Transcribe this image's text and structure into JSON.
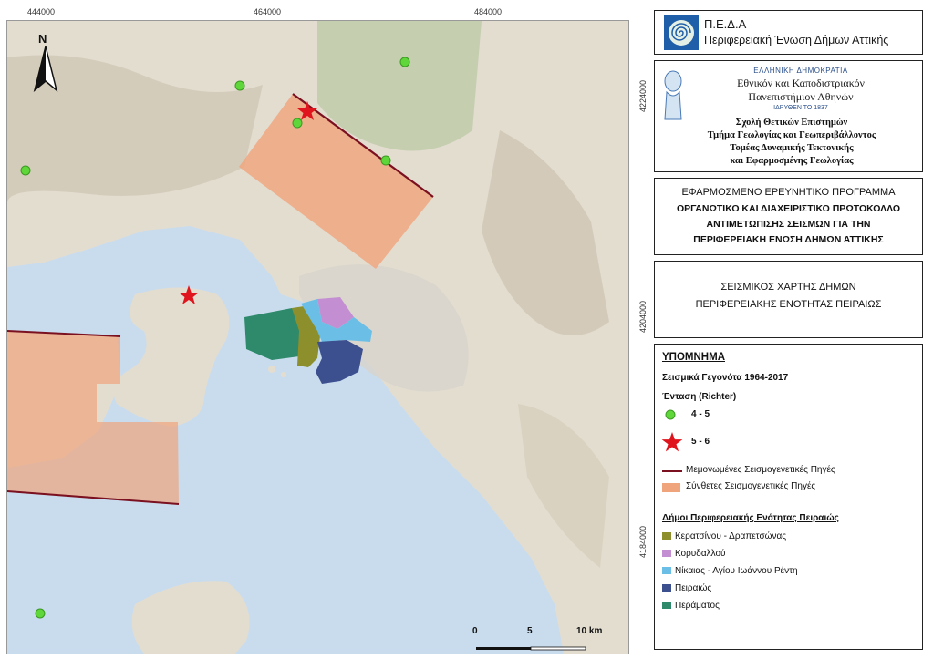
{
  "top_coords": [
    "444000",
    "464000",
    "484000"
  ],
  "side_coords": [
    "4224000",
    "4204000",
    "4184000"
  ],
  "north_arrow": {
    "label": "N",
    "icon": "north-arrow-icon"
  },
  "scalebar": {
    "labels": [
      "0",
      "5",
      "10 km"
    ]
  },
  "colors": {
    "sea": "#c9dcee",
    "land": "#e3ddd0",
    "land_shade": "#cfc6b4",
    "composite_source": "#f0a47c",
    "isolated_source": "#7a1020",
    "event_4_5": "#5fd63a",
    "event_5_6": "#e0141c",
    "keratsini": "#8c8f2c",
    "korydallos": "#c38fd2",
    "nikaia": "#6bbfe6",
    "peiraias": "#3c4f8e",
    "perama": "#2e8a6b"
  },
  "peda": {
    "title": "Π.Ε.Δ.Α",
    "subtitle": "Περιφερειακή Ένωση Δήμων Αττικής",
    "logo_icon": "spiral-logo-icon"
  },
  "university": {
    "state": "ΕΛΛΗΝΙΚΗ ΔΗΜΟΚΡΑΤΙΑ",
    "name_line1": "Εθνικόν και Καποδιστριακόν",
    "name_line2": "Πανεπιστήμιον Αθηνών",
    "founded": "ΙΔΡΥΘΕΝ ΤΟ 1837",
    "line1": "Σχολή Θετικών Επιστημών",
    "line2": "Τμήμα Γεωλογίας και Γεωπεριβάλλοντος",
    "line3": "Τομέας Δυναμικής Τεκτονικής",
    "line4": "και Εφαρμοσμένης Γεωλογίας",
    "logo_icon": "university-seal-icon"
  },
  "program": {
    "title": "ΕΦΑΡΜΟΣΜΕΝΟ ΕΡΕΥΝΗΤΙΚΟ ΠΡΟΓΡΑΜΜΑ",
    "line1": "ΟΡΓΑΝΩΤΙΚΟ ΚΑΙ ΔΙΑΧΕΙΡΙΣΤΙΚΟ ΠΡΩΤΟΚΟΛΛΟ",
    "line2": "ΑΝΤΙΜΕΤΩΠΙΣΗΣ ΣΕΙΣΜΩΝ ΓΙΑ ΤΗΝ",
    "line3": "ΠΕΡΙΦΕΡΕΙΑΚΗ ΕΝΩΣΗ ΔΗΜΩΝ ΑΤΤΙΚΗΣ"
  },
  "map_title": {
    "line1": "ΣΕΙΣΜΙΚΟΣ ΧΑΡΤΗΣ ΔΗΜΩΝ",
    "line2": "ΠΕΡΙΦΕΡΕΙΑΚΗΣ ΕΝΟΤΗΤΑΣ ΠΕΙΡΑΙΩΣ"
  },
  "legend": {
    "heading": "ΥΠΟΜΝΗΜΑ",
    "events_title": "Σεισμικά Γεγονότα 1964-2017",
    "intensity_title": "Ένταση (Richter)",
    "class_4_5": "4 - 5",
    "class_5_6": "5 - 6",
    "isolated_sources": "Μεμονωμένες Σεισμογενετικές Πηγές",
    "composite_sources": "Σύνθετες Σεισμογενετικές Πηγές",
    "municipalities_title": "Δήμοι Περιφερειακής Ενότητας Πειραιώς",
    "municipalities": [
      "Κερατσίνου - Δραπετσώνας",
      "Κορυδαλλού",
      "Νίκαιας - Αγίου Ιωάννου Ρέντη",
      "Πειραιώς",
      "Περάματος"
    ]
  }
}
